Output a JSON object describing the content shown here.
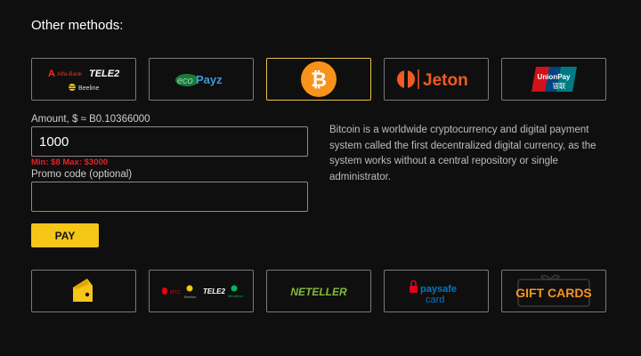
{
  "section_title": "Other methods:",
  "methods_top": [
    {
      "id": "alfa-tele2-beeline",
      "texts": {
        "alfa": "Alfa-Bank",
        "tele2": "TELE2",
        "beeline": "Beeline"
      }
    },
    {
      "id": "ecopayz",
      "texts": {
        "eco": "eco",
        "payz": "Payz"
      }
    },
    {
      "id": "bitcoin",
      "selected": true
    },
    {
      "id": "jeton",
      "texts": {
        "name": "Jeton"
      }
    },
    {
      "id": "unionpay",
      "texts": {
        "name": "UnionPay",
        "cn": "银联"
      }
    }
  ],
  "form": {
    "amount_label": "Amount, $ ≈ B0.10366000",
    "amount_value": "1000",
    "limits": "Min: $8 Max: $3000",
    "promo_label": "Promo code (optional)",
    "promo_value": "",
    "pay_label": "PAY"
  },
  "description": "Bitcoin is a worldwide cryptocurrency and digital payment system called the first decentralized digital currency, as the system works without a central repository or single administrator.",
  "methods_bottom": [
    {
      "id": "yandex-money"
    },
    {
      "id": "mts-beeline-tele2-megafon",
      "texts": {
        "mts": "МТС",
        "tele2": "TELE2",
        "beeline": "Beeline",
        "megafon": "МегаФон"
      }
    },
    {
      "id": "neteller",
      "texts": {
        "name": "NETELLER"
      }
    },
    {
      "id": "paysafecard",
      "texts": {
        "pay": "paysafe",
        "card": "card"
      }
    },
    {
      "id": "gift-cards",
      "texts": {
        "name": "GIFT CARDS"
      }
    }
  ],
  "colors": {
    "accent_yellow": "#f5c518",
    "selected_border": "#e8c44a",
    "error_red": "#e52222",
    "bitcoin_orange": "#f7931a",
    "jeton_orange": "#f15a22",
    "neteller_green": "#83ba3b",
    "paysafe_blue": "#0078c8"
  }
}
